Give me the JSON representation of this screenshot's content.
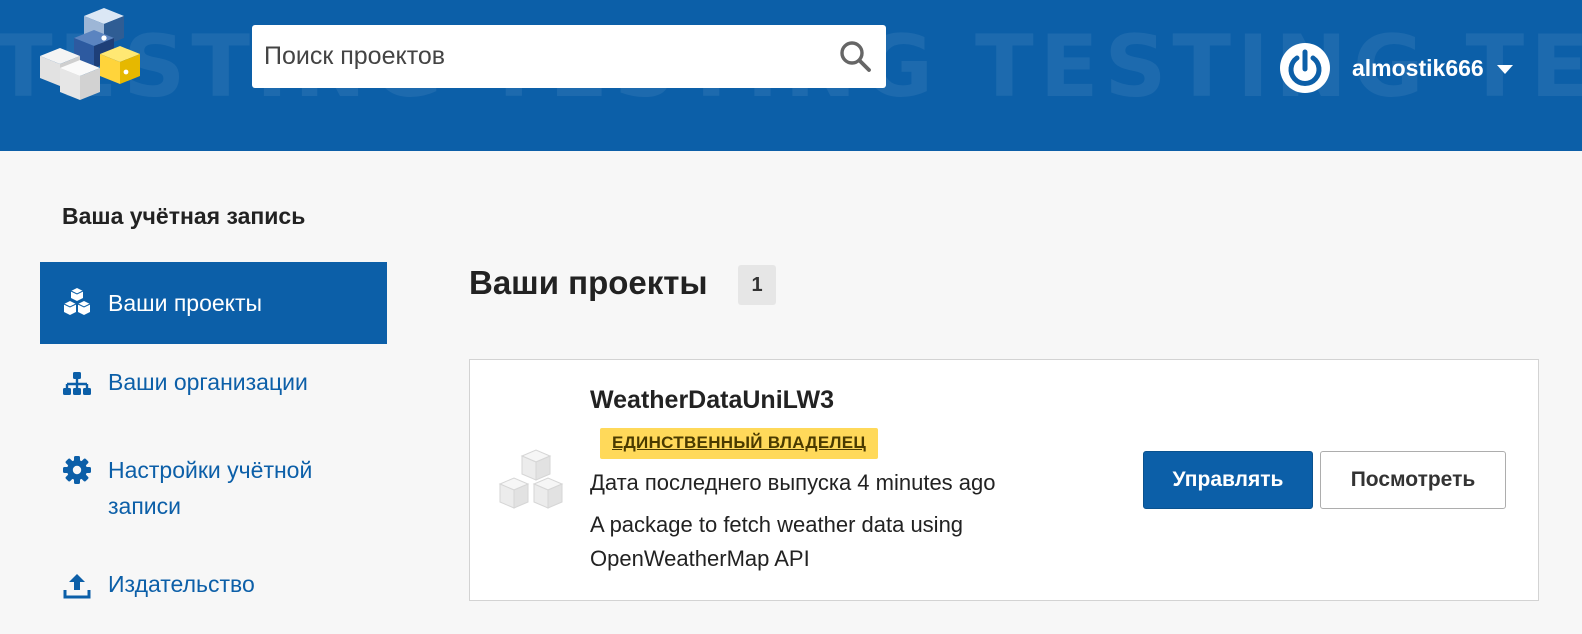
{
  "header": {
    "watermark": "TESTING TESTING TESTING TESTING TESTING",
    "search": {
      "placeholder": "Поиск проектов",
      "value": ""
    },
    "user": {
      "name": "almostik666"
    },
    "colors": {
      "brand": "#0c5fa8"
    }
  },
  "sidebar": {
    "title": "Ваша учётная запись",
    "items": [
      {
        "label": "Ваши проекты",
        "icon": "cubes-icon",
        "active": true
      },
      {
        "label": "Ваши организации",
        "icon": "sitemap-icon",
        "active": false
      },
      {
        "label": "Настройки учётной записи",
        "icon": "gear-icon",
        "active": false
      },
      {
        "label": "Издательство",
        "icon": "upload-icon",
        "active": false
      }
    ]
  },
  "main": {
    "title": "Ваши проекты",
    "count": "1",
    "projects": [
      {
        "name": "WeatherDataUniLW3",
        "badge": "ЕДИНСТВЕННЫЙ ВЛАДЕЛЕЦ",
        "release": "Дата последнего выпуска 4 minutes ago",
        "description": "A package to fetch weather data using OpenWeatherMap API",
        "manage_label": "Управлять",
        "view_label": "Посмотреть"
      }
    ]
  }
}
